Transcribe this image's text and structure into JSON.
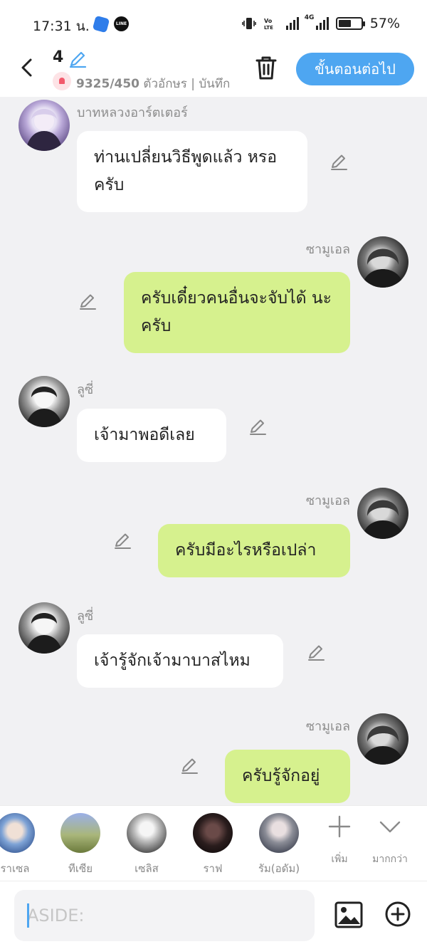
{
  "status_bar": {
    "time": "17:31 น.",
    "battery": "57%",
    "battery_level": 0.57,
    "network_label": "4G"
  },
  "header": {
    "episode_number": "4",
    "char_count": "9325/450",
    "char_suffix": " ตัวอักษร | บันทึก",
    "next_label": "ขั้นตอนต่อไป"
  },
  "messages": [
    {
      "side": "left",
      "name": "บาทหลวงอาร์ตเตอร์",
      "text": "ท่านเปลี่ยนวิธีพูดแล้ว หรอครับ",
      "avatar": "avatar-arthur"
    },
    {
      "side": "right",
      "name": "ซามูเอล",
      "text": "ครับเดี๋ยวคนอื่นจะจับได้ นะครับ",
      "avatar": "avatar-samuel"
    },
    {
      "side": "left",
      "name": "ลูซี่",
      "text": "เจ้ามาพอดีเลย",
      "avatar": "avatar-lucy"
    },
    {
      "side": "right",
      "name": "ซามูเอล",
      "text": "ครับมีอะไรหรือเปล่า",
      "avatar": "avatar-samuel"
    },
    {
      "side": "left",
      "name": "ลูซี่",
      "text": "เจ้ารู้จักเจ้ามาบาสไหม",
      "avatar": "avatar-lucy"
    },
    {
      "side": "right",
      "name": "ซามูเอล",
      "text": "ครับรู้จักอยู่",
      "avatar": "avatar-samuel"
    }
  ],
  "characters": [
    {
      "label": "ราเซล"
    },
    {
      "label": "ทีเซีย"
    },
    {
      "label": "เซลิส"
    },
    {
      "label": "ราฟ"
    },
    {
      "label": "รัม(อดัม)"
    }
  ],
  "tools": {
    "add_label": "เพิ่ม",
    "more_label": "มากกว่า"
  },
  "input": {
    "placeholder": "ASIDE:"
  },
  "colors": {
    "accent": "#4ea6f1",
    "my_bubble": "#d6f18e",
    "other_bubble": "#ffffff",
    "background": "#f1f1f3"
  }
}
